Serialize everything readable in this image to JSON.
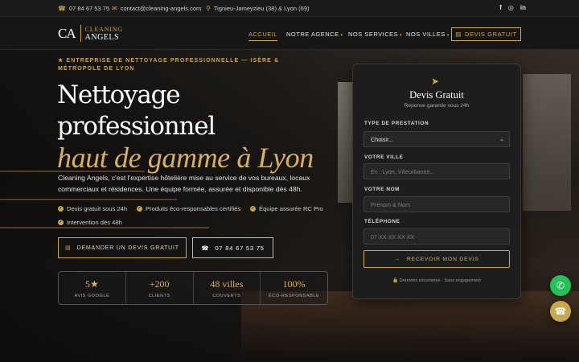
{
  "topbar": {
    "phone": "07 84 67 53 75",
    "email": "contact@cleaning-angels.com",
    "location": "Tignieu-Jameyzieu (38) & Lyon (69)",
    "social_icons": [
      "facebook-icon",
      "instagram-icon",
      "linkedin-icon"
    ]
  },
  "header": {
    "logo_mark": "CA",
    "logo_line1": "CLEANING",
    "logo_line2": "ANGELS",
    "nav": [
      {
        "label": "ACCUEIL",
        "active": true,
        "dropdown": false
      },
      {
        "label": "NOTRE AGENCE",
        "active": false,
        "dropdown": true
      },
      {
        "label": "NOS SERVICES",
        "active": false,
        "dropdown": true
      },
      {
        "label": "NOS VILLES",
        "active": false,
        "dropdown": true
      }
    ],
    "cta_label": "DEVIS GRATUIT"
  },
  "hero": {
    "eyebrow": "★ ENTREPRISE DE NETTOYAGE PROFESSIONNELLE — ISÈRE & MÉTROPOLE DE LYON",
    "title_line1": "Nettoyage",
    "title_line2": "professionnel",
    "title_line3": "haut de gamme à Lyon",
    "lede": "Cleaning Angels, c'est l'expertise hôtelière mise au service de vos bureaux, locaux commerciaux et résidences. Une équipe formée, assurée et disponible dès 48h.",
    "checks": [
      "Devis gratuit sous 24h",
      "Produits éco-responsables certifiés",
      "Équipe assurée RC Pro",
      "Intervention dès 48h"
    ],
    "cta_primary": "DEMANDER UN DEVIS GRATUIT",
    "cta_phone": "07 84 67 53 75",
    "stats": [
      {
        "value": "5★",
        "label": "AVIS GOOGLE"
      },
      {
        "value": "+200",
        "label": "CLIENTS"
      },
      {
        "value": "48 villes",
        "label": "COUVERTS"
      },
      {
        "value": "100%",
        "label": "ÉCO-RESPONSABLE"
      }
    ]
  },
  "form": {
    "title": "Devis Gratuit",
    "subtitle": "Réponse garantie sous 24h",
    "type_label": "TYPE DE PRESTATION",
    "type_value": "Choisir...",
    "city_label": "VOTRE VILLE",
    "city_placeholder": "Ex : Lyon, Villeurbanne...",
    "name_label": "VOTRE NOM",
    "name_placeholder": "Prénom & Nom",
    "phone_label": "TÉLÉPHONE",
    "phone_placeholder": "07 XX XX XX XX",
    "submit_label": "RECEVOIR MON DEVIS",
    "secure_note": "🔒 Données sécurisées · Sans engagement"
  },
  "colors": {
    "accent": "#c9a84c",
    "whatsapp": "#25c05a",
    "card": "#1d1d1d"
  }
}
